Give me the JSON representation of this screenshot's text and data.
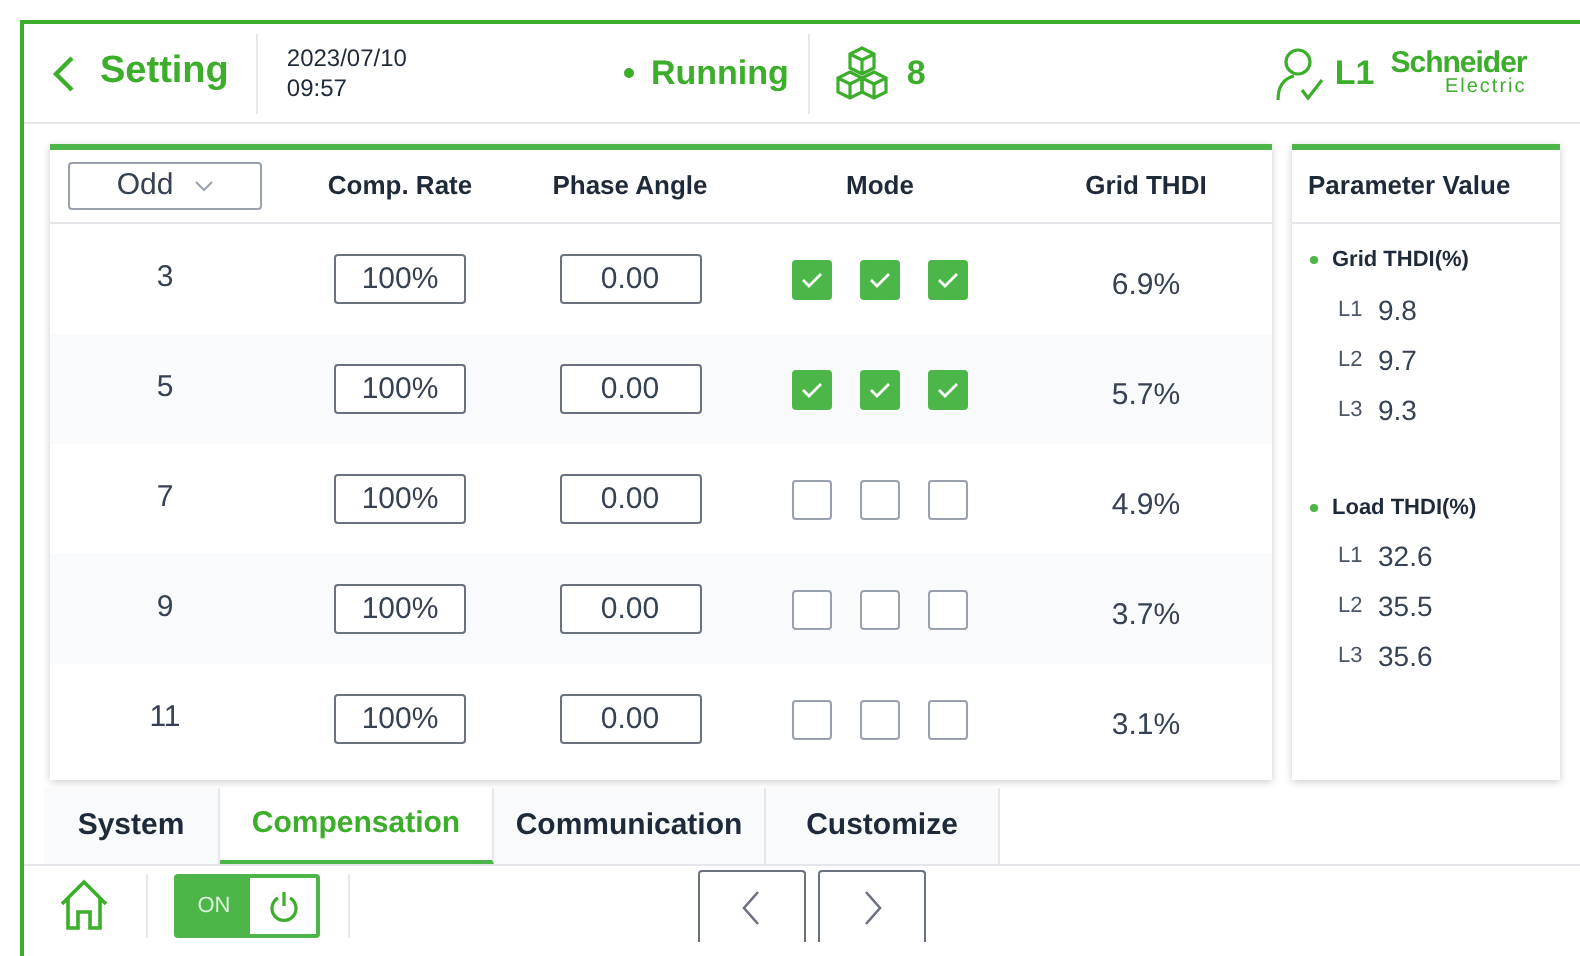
{
  "header": {
    "back_label": "Setting",
    "date": "2023/07/10",
    "time": "09:57",
    "status": "Running",
    "module_count": "8",
    "user_level": "L1",
    "brand_line1": "Schneider",
    "brand_line2": "Electric"
  },
  "table": {
    "filter": "Odd",
    "columns": [
      "Comp. Rate",
      "Phase Angle",
      "Mode",
      "Grid THDI"
    ],
    "rows": [
      {
        "order": "3",
        "comp_rate": "100%",
        "phase_angle": "0.00",
        "mode": [
          {
            "checked": true
          },
          {
            "checked": true
          },
          {
            "checked": true
          }
        ],
        "grid_thdi": "6.9%"
      },
      {
        "order": "5",
        "comp_rate": "100%",
        "phase_angle": "0.00",
        "mode": [
          {
            "checked": true
          },
          {
            "checked": true
          },
          {
            "checked": true
          }
        ],
        "grid_thdi": "5.7%"
      },
      {
        "order": "7",
        "comp_rate": "100%",
        "phase_angle": "0.00",
        "mode": [
          {
            "checked": false
          },
          {
            "checked": false
          },
          {
            "checked": false
          }
        ],
        "grid_thdi": "4.9%"
      },
      {
        "order": "9",
        "comp_rate": "100%",
        "phase_angle": "0.00",
        "mode": [
          {
            "checked": false
          },
          {
            "checked": false
          },
          {
            "checked": false
          }
        ],
        "grid_thdi": "3.7%"
      },
      {
        "order": "11",
        "comp_rate": "100%",
        "phase_angle": "0.00",
        "mode": [
          {
            "checked": false
          },
          {
            "checked": false
          },
          {
            "checked": false
          }
        ],
        "grid_thdi": "3.1%"
      }
    ]
  },
  "parameter_panel": {
    "title": "Parameter Value",
    "groups": [
      {
        "label": "Grid THDI(%)",
        "items": [
          {
            "phase": "L1",
            "value": "9.8"
          },
          {
            "phase": "L2",
            "value": "9.7"
          },
          {
            "phase": "L3",
            "value": "9.3"
          }
        ]
      },
      {
        "label": "Load THDI(%)",
        "items": [
          {
            "phase": "L1",
            "value": "32.6"
          },
          {
            "phase": "L2",
            "value": "35.5"
          },
          {
            "phase": "L3",
            "value": "35.6"
          }
        ]
      }
    ]
  },
  "tabs": [
    {
      "label": "System",
      "selected": false
    },
    {
      "label": "Compensation",
      "selected": true
    },
    {
      "label": "Communication",
      "selected": false
    },
    {
      "label": "Customize",
      "selected": false
    }
  ],
  "power_switch": {
    "label": "ON",
    "on": true
  }
}
